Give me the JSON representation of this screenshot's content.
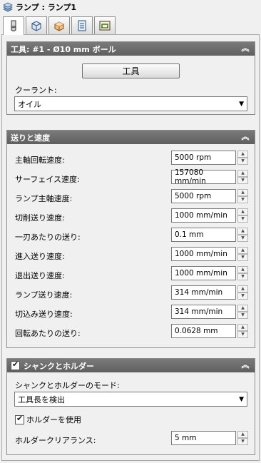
{
  "window": {
    "title": "ランプ : ランプ1"
  },
  "tabs": [
    {
      "icon": "tool-icon",
      "active": true
    },
    {
      "icon": "cube-outline-icon",
      "active": false
    },
    {
      "icon": "stock-box-icon",
      "active": false
    },
    {
      "icon": "document-list-icon",
      "active": false
    },
    {
      "icon": "linking-icon",
      "active": false
    }
  ],
  "tool_section": {
    "title": "工具: #1 - Ø10 mm ボール",
    "tool_button_label": "工具",
    "coolant_label": "クーラント:",
    "coolant_value": "オイル"
  },
  "feeds_section": {
    "title": "送りと速度",
    "rows": [
      {
        "label": "主軸回転速度:",
        "value": "5000 rpm"
      },
      {
        "label": "サーフェイス速度:",
        "value": "157080 mm/min"
      },
      {
        "label": "ランプ主軸速度:",
        "value": "5000 rpm"
      },
      {
        "label": "切削送り速度:",
        "value": "1000 mm/min"
      },
      {
        "label": "一刃あたりの送り:",
        "value": "0.1 mm"
      },
      {
        "label": "進入送り速度:",
        "value": "1000 mm/min"
      },
      {
        "label": "退出送り速度:",
        "value": "1000 mm/min"
      },
      {
        "label": "ランプ送り速度:",
        "value": "314 mm/min"
      },
      {
        "label": "切込み送り速度:",
        "value": "314 mm/min"
      },
      {
        "label": "回転あたりの送り:",
        "value": "0.0628 mm"
      }
    ]
  },
  "shank_section": {
    "title": "シャンクとホルダー",
    "enabled": true,
    "mode_label": "シャンクとホルダーのモード:",
    "mode_value": "工具長を検出",
    "use_holder_label": "ホルダーを使用",
    "use_holder_checked": true,
    "clearance_label": "ホルダークリアランス:",
    "clearance_value": "5 mm"
  },
  "colors": {
    "section_header": "#6b6b6b",
    "background": "#f0f0f0"
  }
}
